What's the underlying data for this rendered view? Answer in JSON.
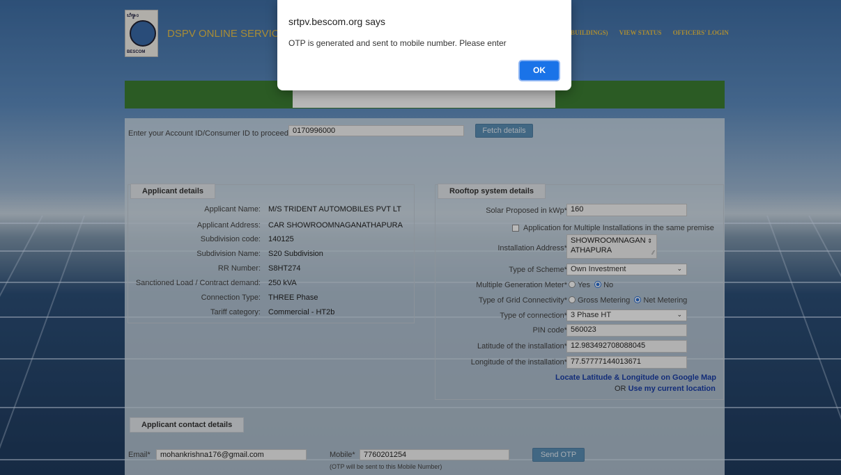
{
  "header": {
    "logo_top": "ಬೆಸ್ಕಾಂ",
    "logo_bottom": "BESCOM",
    "brand": "DSPV ONLINE SERVICES",
    "nav": [
      " BUILDINGS)",
      "VIEW STATUS",
      "OFFICERS' LOGIN"
    ]
  },
  "account": {
    "label": "Enter your Account ID/Consumer ID to proceed",
    "value": "0170996000",
    "fetch_label": "Fetch details"
  },
  "applicant": {
    "legend": "Applicant details",
    "rows": [
      {
        "label": "Applicant Name:",
        "value": "M/S TRIDENT AUTOMOBILES PVT LT"
      },
      {
        "label": "Applicant Address:",
        "value": "CAR SHOWROOMNAGANATHAPURA"
      },
      {
        "label": "Subdivision code:",
        "value": "140125"
      },
      {
        "label": "Subdivision Name:",
        "value": "S20 Subdivision"
      },
      {
        "label": "RR Number:",
        "value": "S8HT274"
      },
      {
        "label": "Sanctioned Load / Contract demand:",
        "value": "250 kVA"
      },
      {
        "label": "Connection Type:",
        "value": "THREE Phase"
      },
      {
        "label": "Tariff category:",
        "value": "Commercial - HT2b"
      }
    ]
  },
  "rooftop": {
    "legend": "Rooftop system details",
    "solar_label": "Solar Proposed in kWp*",
    "solar_value": "160",
    "multi_install_label": "Application for Multiple Installations in the same premise",
    "address_label": "Installation Address*",
    "address_value_1": "SHOWROOMNAGAN",
    "address_value_2": "ATHAPURA",
    "scheme_label": "Type of Scheme*",
    "scheme_value": "Own Investment",
    "mgm_label": "Multiple Generation Meter*",
    "mgm_yes": "Yes",
    "mgm_no": "No",
    "grid_label": "Type of Grid Connectivity*",
    "grid_gross": "Gross Metering",
    "grid_net": "Net Metering",
    "conn_label": "Type of connection*",
    "conn_value": "3 Phase HT",
    "pin_label": "PIN code*",
    "pin_value": "560023",
    "lat_label": "Latitude of the installation*",
    "lat_value": "12.983492708088045",
    "lng_label": "Longitude of the installation*",
    "lng_value": "77.57777144013671",
    "locate_link": "Locate Latitude & Longitude on Google Map",
    "or_text": "OR",
    "current_link": "Use my current location"
  },
  "contact": {
    "legend": "Applicant contact details",
    "email_label": "Email*",
    "email_value": "mohankrishna176@gmail.com",
    "mobile_label": "Mobile*",
    "mobile_value": "7760201254",
    "otp_note": "(OTP will be sent to this Mobile Number)",
    "send_otp_label": "Send OTP"
  },
  "dialog": {
    "title": "srtpv.bescom.org says",
    "message": "OTP is generated and sent to mobile number. Please enter",
    "ok_label": "OK"
  }
}
